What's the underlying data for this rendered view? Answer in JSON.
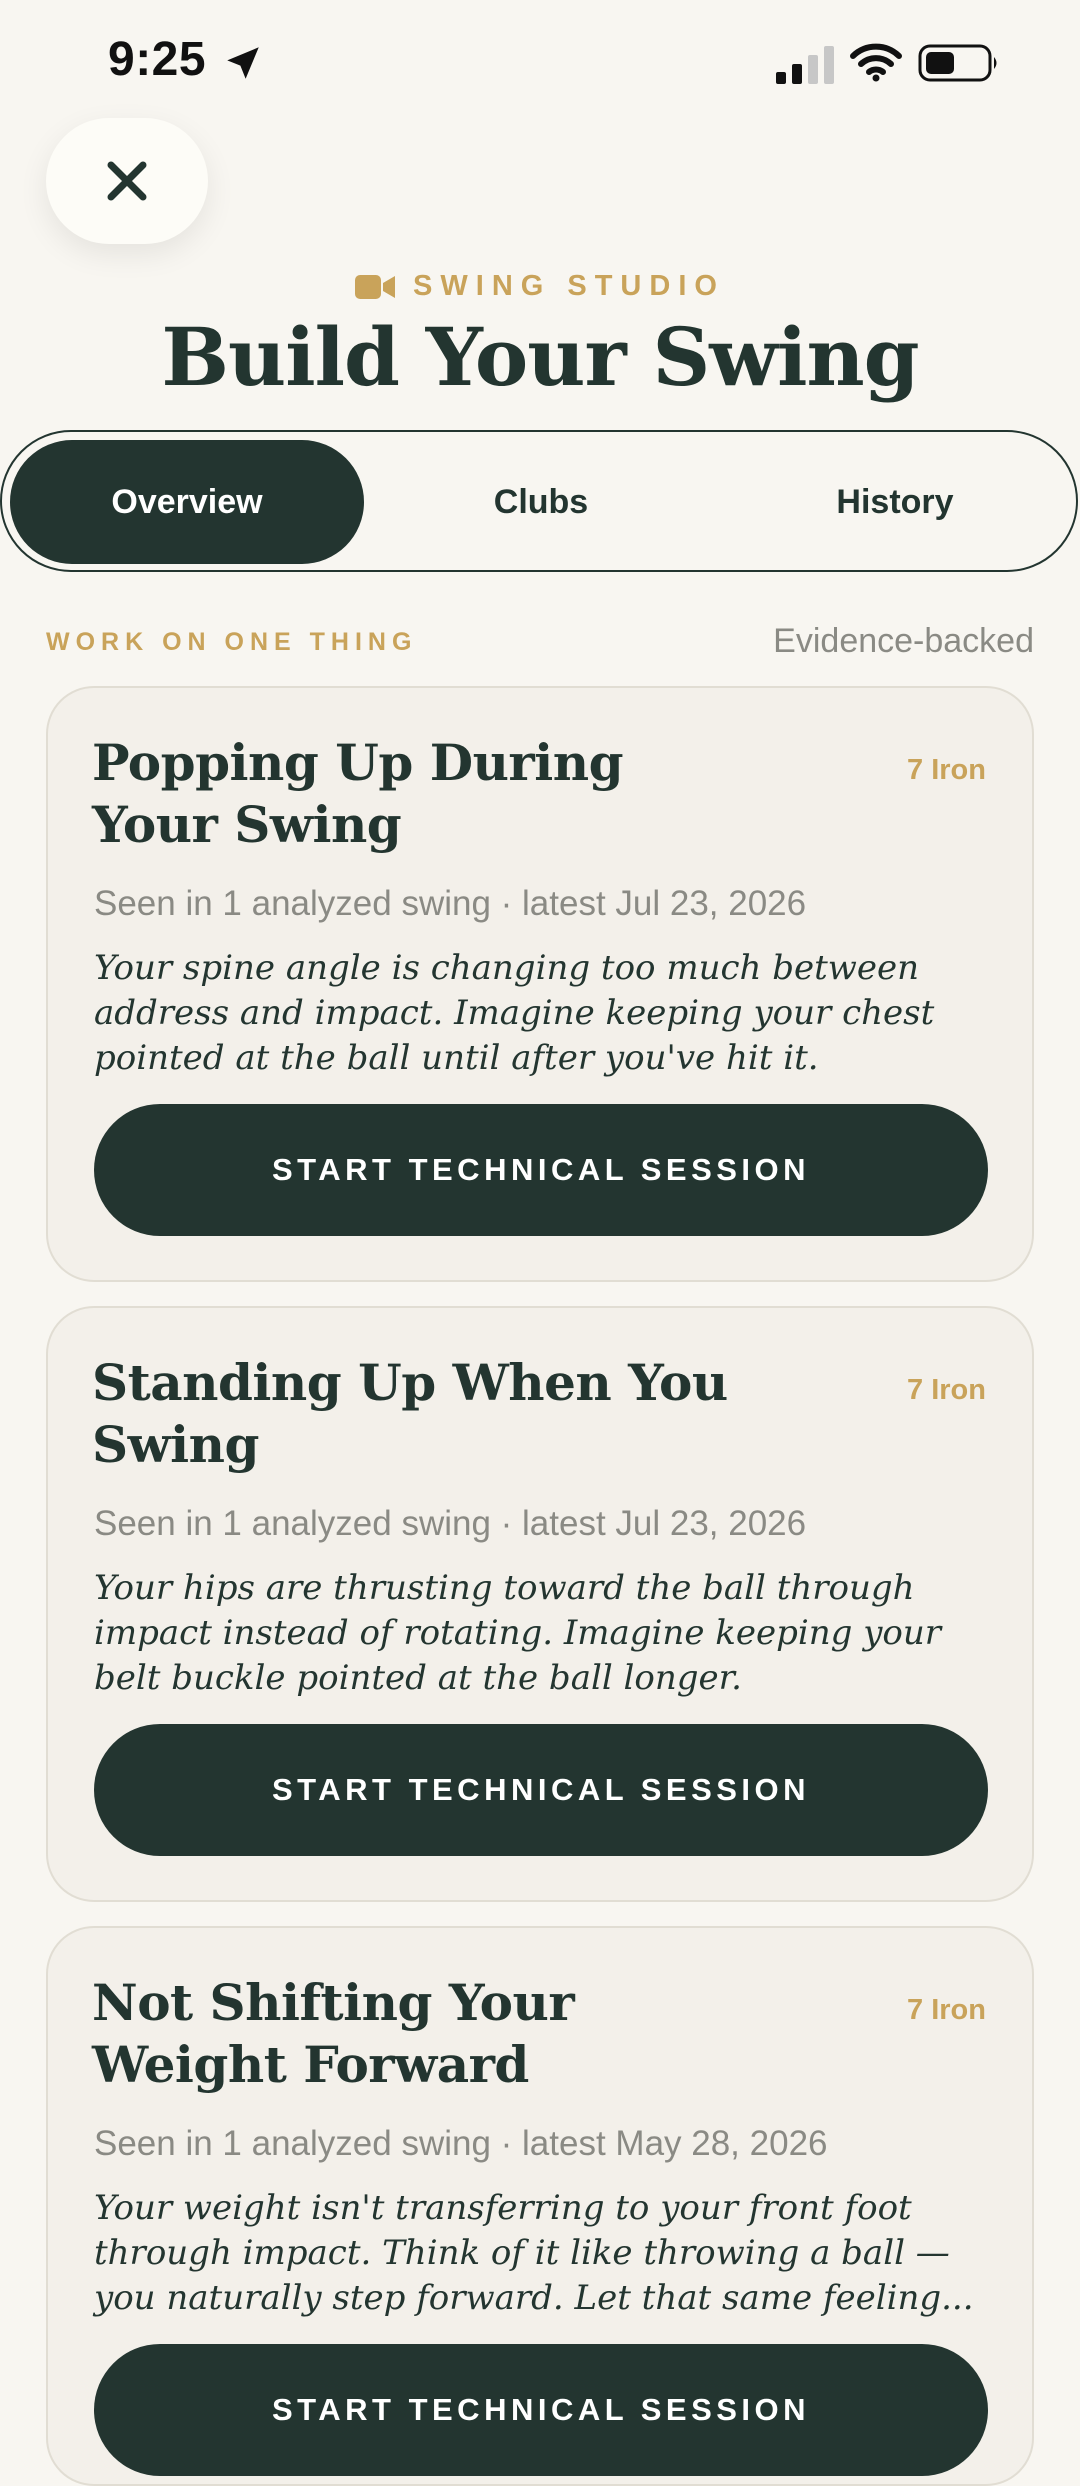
{
  "status_bar": {
    "time": "9:25"
  },
  "icons": {
    "location": "location-arrow-icon",
    "signal": "cellular-signal-icon",
    "wifi": "wifi-icon",
    "battery": "battery-icon",
    "close": "close-icon",
    "video": "video-camera-icon"
  },
  "header": {
    "eyebrow": "SWING STUDIO",
    "title": "Build Your Swing"
  },
  "tabs": [
    {
      "label": "Overview",
      "active": true
    },
    {
      "label": "Clubs",
      "active": false
    },
    {
      "label": "History",
      "active": false
    }
  ],
  "section": {
    "title": "WORK ON ONE THING",
    "note": "Evidence-backed"
  },
  "cards": [
    {
      "title": "Popping Up During Your Swing",
      "club": "7 Iron",
      "meta": "Seen in 1 analyzed swing · latest Jul 23, 2026",
      "description": "Your spine angle is changing too much between address and impact. Imagine keeping your chest pointed at the ball until after you've hit it.",
      "button": "START TECHNICAL SESSION"
    },
    {
      "title": "Standing Up When You Swing",
      "club": "7 Iron",
      "meta": "Seen in 1 analyzed swing · latest Jul 23, 2026",
      "description": "Your hips are thrusting toward the ball through impact instead of rotating. Imagine keeping your belt buckle pointed at the ball longer.",
      "button": "START TECHNICAL SESSION"
    },
    {
      "title": "Not Shifting Your Weight Forward",
      "club": "7 Iron",
      "meta": "Seen in 1 analyzed swing · latest May 28, 2026",
      "description": "Your weight isn't transferring to your front foot through impact. Think of it like throwing a ball — you naturally step forward. Let that same feeling...",
      "button": "START TECHNICAL SESSION"
    }
  ],
  "colors": {
    "background": "#f8f6f1",
    "primary": "#233530",
    "accent": "#c9a35a",
    "muted": "#8a8a84",
    "card": "#f3f0ea"
  }
}
